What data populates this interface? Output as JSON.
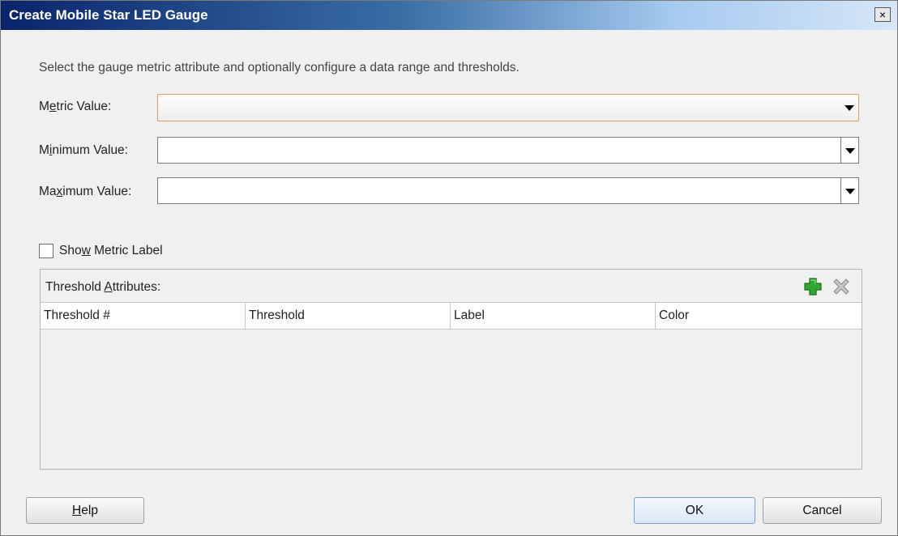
{
  "window": {
    "title": "Create Mobile Star LED Gauge",
    "close_label": "×"
  },
  "instruction": "Select the gauge metric attribute and optionally configure a data range and thresholds.",
  "fields": {
    "metric": {
      "label_pre": "M",
      "label_acc": "e",
      "label_post": "tric Value:",
      "value": ""
    },
    "minimum": {
      "label_pre": "M",
      "label_acc": "i",
      "label_post": "nimum Value:",
      "value": ""
    },
    "maximum": {
      "label_pre": "Ma",
      "label_acc": "x",
      "label_post": "imum Value:",
      "value": ""
    }
  },
  "show_metric_label": {
    "pre": "Sho",
    "acc": "w",
    "post": " Metric Label",
    "checked": false
  },
  "thresholds": {
    "title_pre": "Threshold ",
    "title_acc": "A",
    "title_post": "ttributes:",
    "columns": [
      "Threshold #",
      "Threshold",
      "Label",
      "Color"
    ],
    "rows": []
  },
  "buttons": {
    "help_acc": "H",
    "help_post": "elp",
    "ok": "OK",
    "cancel": "Cancel"
  },
  "icons": {
    "add": "add-plus-icon",
    "remove": "remove-x-icon"
  },
  "colors": {
    "title_start": "#0a246a",
    "metric_border": "#d5a35a",
    "add_icon": "#2fa82f"
  }
}
